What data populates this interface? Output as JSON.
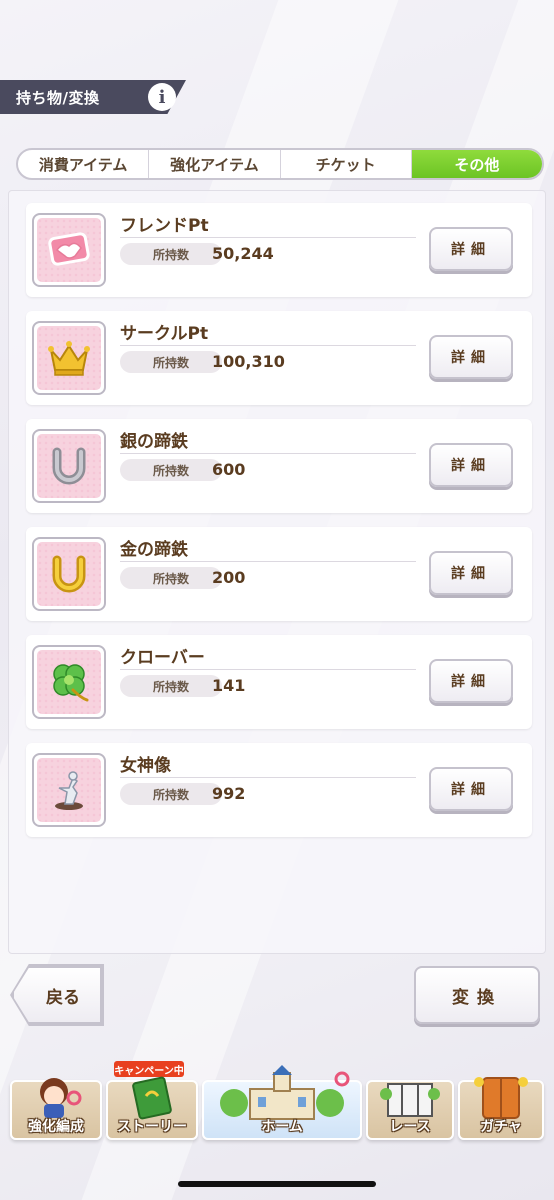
{
  "header": {
    "title": "持ち物/変換",
    "info_label": "i"
  },
  "tabs": [
    {
      "label": "消費アイテム",
      "active": false
    },
    {
      "label": "強化アイテム",
      "active": false
    },
    {
      "label": "チケット",
      "active": false
    },
    {
      "label": "その他",
      "active": true
    }
  ],
  "items": [
    {
      "name": "フレンドPt",
      "owned_label": "所持数",
      "count": "50,244",
      "detail_label": "詳細",
      "icon": "handshake-icon"
    },
    {
      "name": "サークルPt",
      "owned_label": "所持数",
      "count": "100,310",
      "detail_label": "詳細",
      "icon": "crown-icon"
    },
    {
      "name": "銀の蹄鉄",
      "owned_label": "所持数",
      "count": "600",
      "detail_label": "詳細",
      "icon": "silver-horseshoe-icon"
    },
    {
      "name": "金の蹄鉄",
      "owned_label": "所持数",
      "count": "200",
      "detail_label": "詳細",
      "icon": "gold-horseshoe-icon"
    },
    {
      "name": "クローバー",
      "owned_label": "所持数",
      "count": "141",
      "detail_label": "詳細",
      "icon": "clover-icon"
    },
    {
      "name": "女神像",
      "owned_label": "所持数",
      "count": "992",
      "detail_label": "詳細",
      "icon": "goddess-statue-icon"
    }
  ],
  "footer": {
    "back_label": "戻る",
    "convert_label": "変換"
  },
  "nav": {
    "campaign_badge": "キャンペーン中",
    "items": [
      {
        "label": "強化編成",
        "icon": "character-icon"
      },
      {
        "label": "ストーリー",
        "icon": "book-icon"
      },
      {
        "label": "ホーム",
        "icon": "building-icon"
      },
      {
        "label": "レース",
        "icon": "gate-icon"
      },
      {
        "label": "ガチャ",
        "icon": "gacha-door-icon"
      }
    ]
  },
  "colors": {
    "accent_green": "#6cc424",
    "text_brown": "#5a3c20",
    "header_dark": "#4a4a5e"
  }
}
